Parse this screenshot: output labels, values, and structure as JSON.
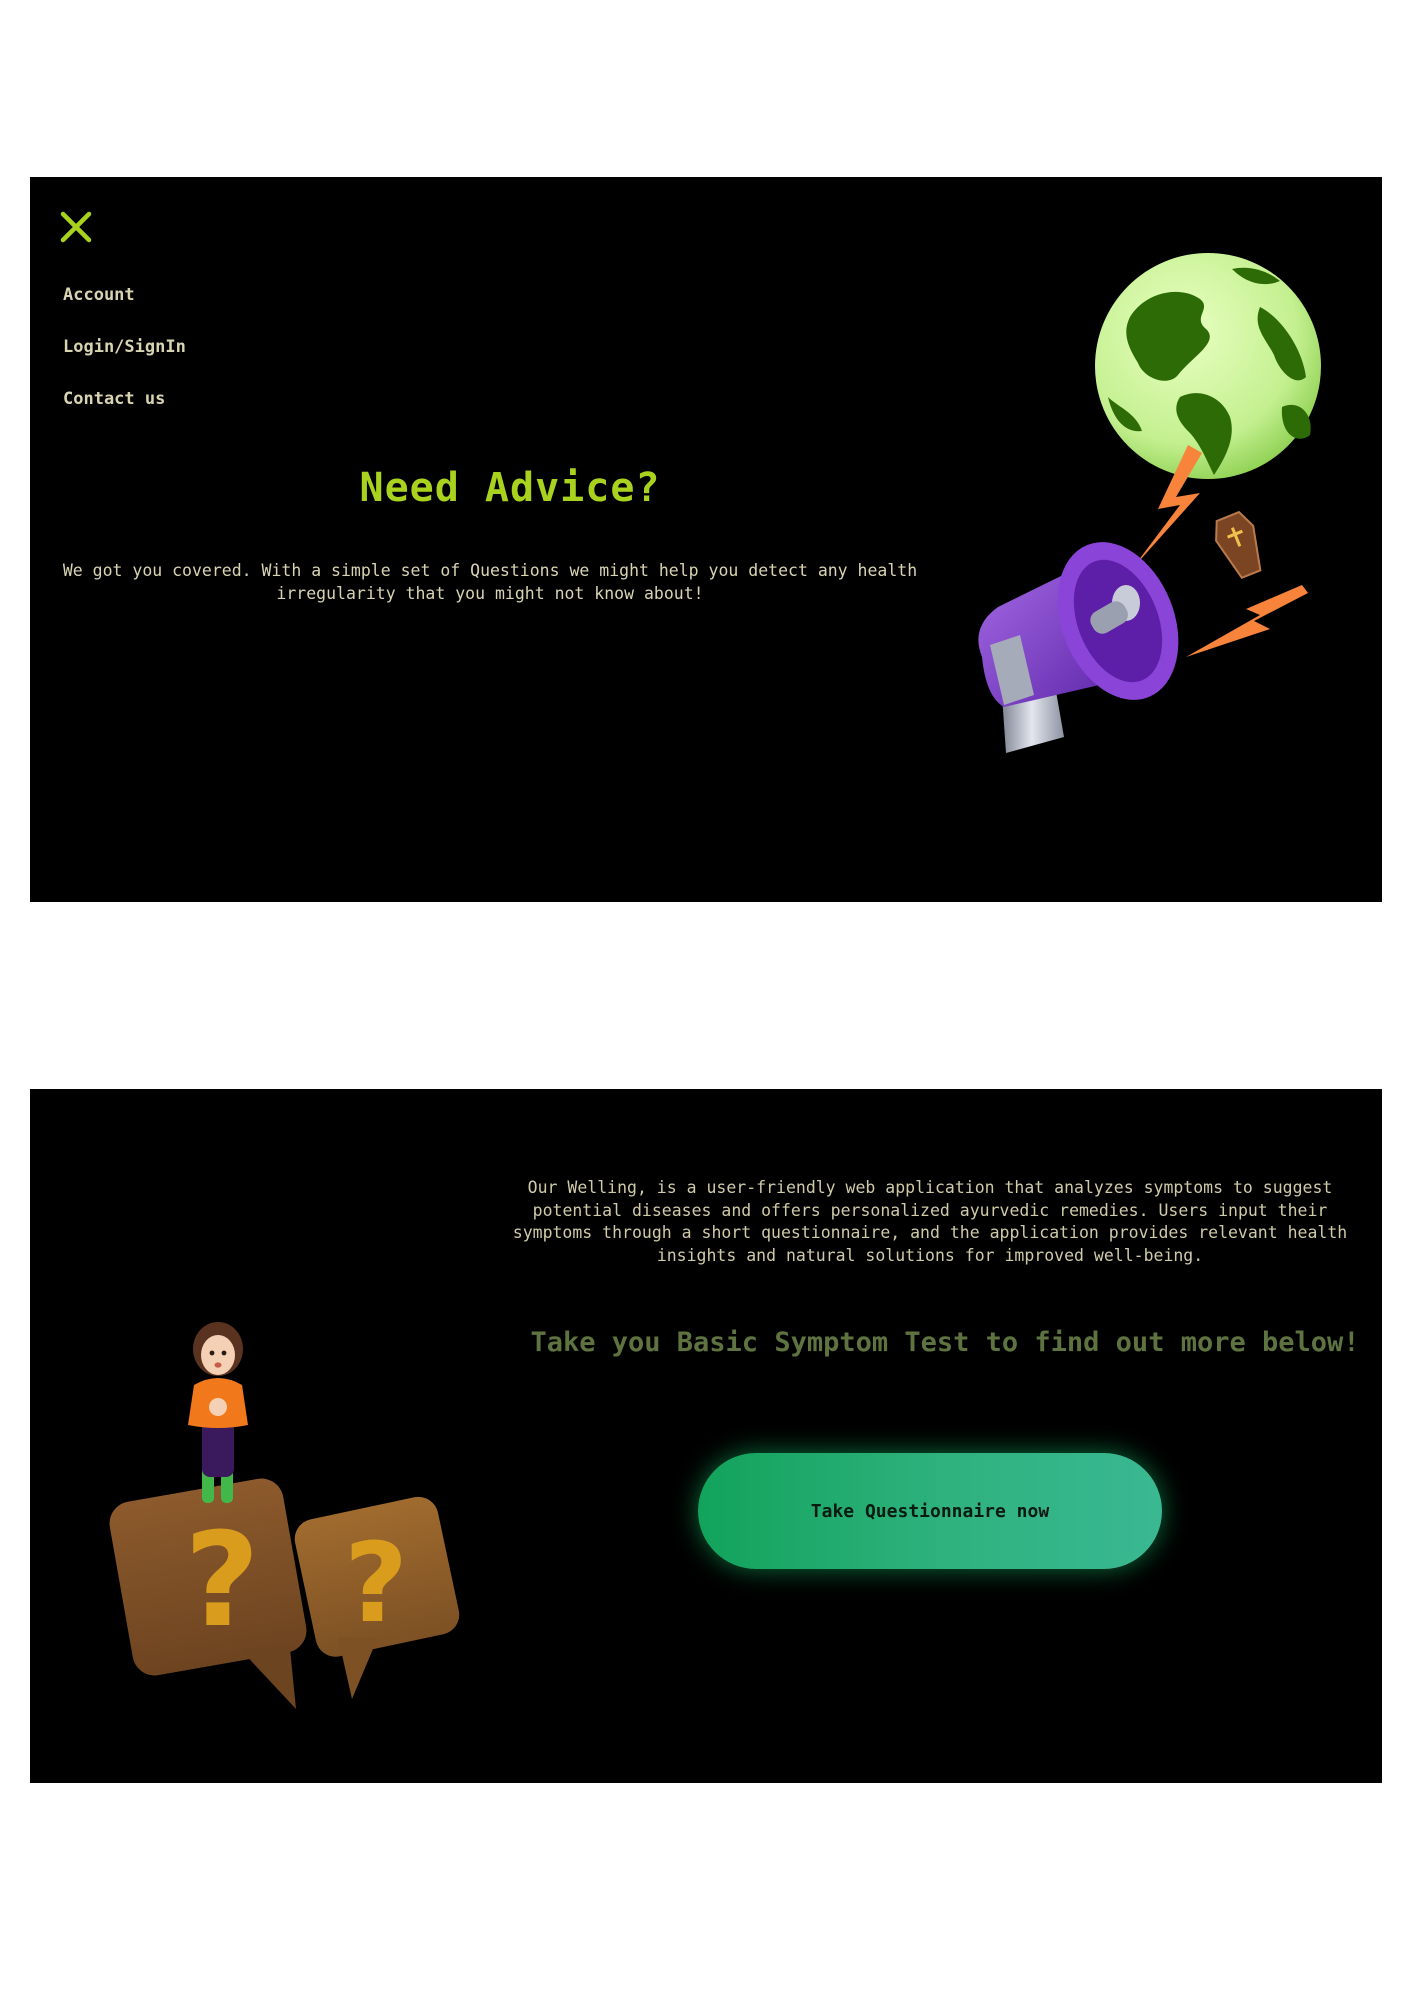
{
  "menu": {
    "items": [
      {
        "label": "Account"
      },
      {
        "label": "Login/SignIn"
      },
      {
        "label": "Contact us"
      }
    ]
  },
  "hero": {
    "title": "Need Advice?",
    "description": "We got you covered. With a simple set of Questions we might help you detect any health irregularity that you might not know about!"
  },
  "about": {
    "description": "Our Welling, is a user-friendly web application that analyzes symptoms to suggest potential diseases and offers personalized ayurvedic remedies. Users input their symptoms through a short questionnaire, and the application provides relevant health insights and natural solutions for improved well-being."
  },
  "cta": {
    "heading": "Take you Basic Symptom Test to find out more below!",
    "button_label": "Take Questionnaire now"
  },
  "icons": {
    "close": "close-icon",
    "globe": "globe-illustration",
    "megaphone": "megaphone-illustration",
    "person": "person-illustration",
    "question": "question-bubble-illustration"
  },
  "colors": {
    "accent": "#a8d21e",
    "panel_bg": "#000000",
    "body_text": "#d8d4b2",
    "cta_heading": "#5e7340",
    "button_start": "#12a35b",
    "button_end": "#3ab892"
  }
}
